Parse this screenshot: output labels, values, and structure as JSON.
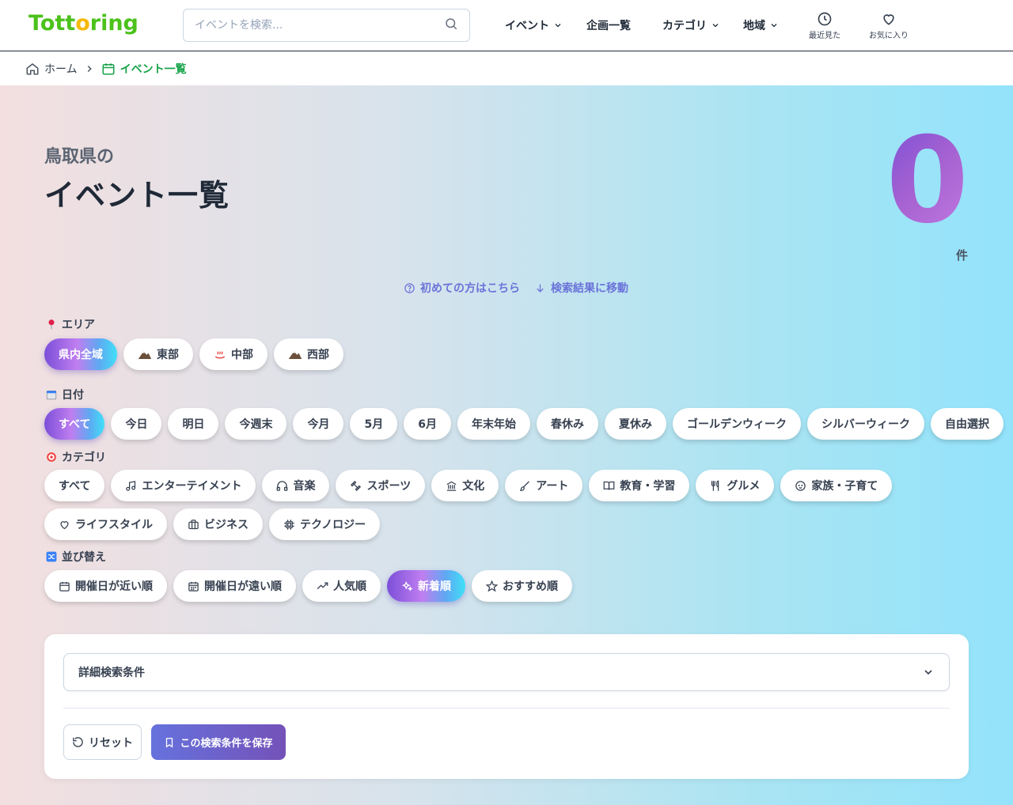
{
  "header": {
    "logo_prefix": "Tott",
    "logo_accent": "o",
    "logo_suffix": "ring",
    "search_placeholder": "イベントを検索...",
    "nav": [
      {
        "label": "イベント"
      },
      {
        "label": "企画一覧"
      },
      {
        "label": "カテゴリ"
      },
      {
        "label": "地域"
      }
    ],
    "recent_label": "最近見た",
    "favorite_label": "お気に入り"
  },
  "breadcrumb": {
    "home": "ホーム",
    "current": "イベント一覧"
  },
  "hero": {
    "subtitle": "鳥取県の",
    "title": "イベント一覧",
    "count": "0",
    "count_unit": "件",
    "link_first_time": "初めての方はこちら",
    "link_jump": "検索結果に移動"
  },
  "area": {
    "label": "エリア",
    "options": [
      "県内全域",
      "東部",
      "中部",
      "西部"
    ],
    "selected": "県内全域"
  },
  "date": {
    "label": "日付",
    "options": [
      "すべて",
      "今日",
      "明日",
      "今週末",
      "今月",
      "5月",
      "6月",
      "年末年始",
      "春休み",
      "夏休み",
      "ゴールデンウィーク",
      "シルバーウィーク",
      "自由選択"
    ],
    "selected": "すべて"
  },
  "category": {
    "label": "カテゴリ",
    "options": [
      "すべて",
      "エンターテイメント",
      "音楽",
      "スポーツ",
      "文化",
      "アート",
      "教育・学習",
      "グルメ",
      "家族・子育て",
      "ライフスタイル",
      "ビジネス",
      "テクノロジー"
    ]
  },
  "sort": {
    "label": "並び替え",
    "options": [
      "開催日が近い順",
      "開催日が遠い順",
      "人気順",
      "新着順",
      "おすすめ順"
    ],
    "selected": "新着順"
  },
  "filters": {
    "detail_label": "詳細検索条件",
    "reset_label": "リセット",
    "save_label": "この検索条件を保存"
  },
  "colors": {
    "brand_green": "#4cc21b",
    "brand_yellow": "#f5b90a",
    "link": "#6b73d9",
    "active_crumb": "#16a34a"
  }
}
